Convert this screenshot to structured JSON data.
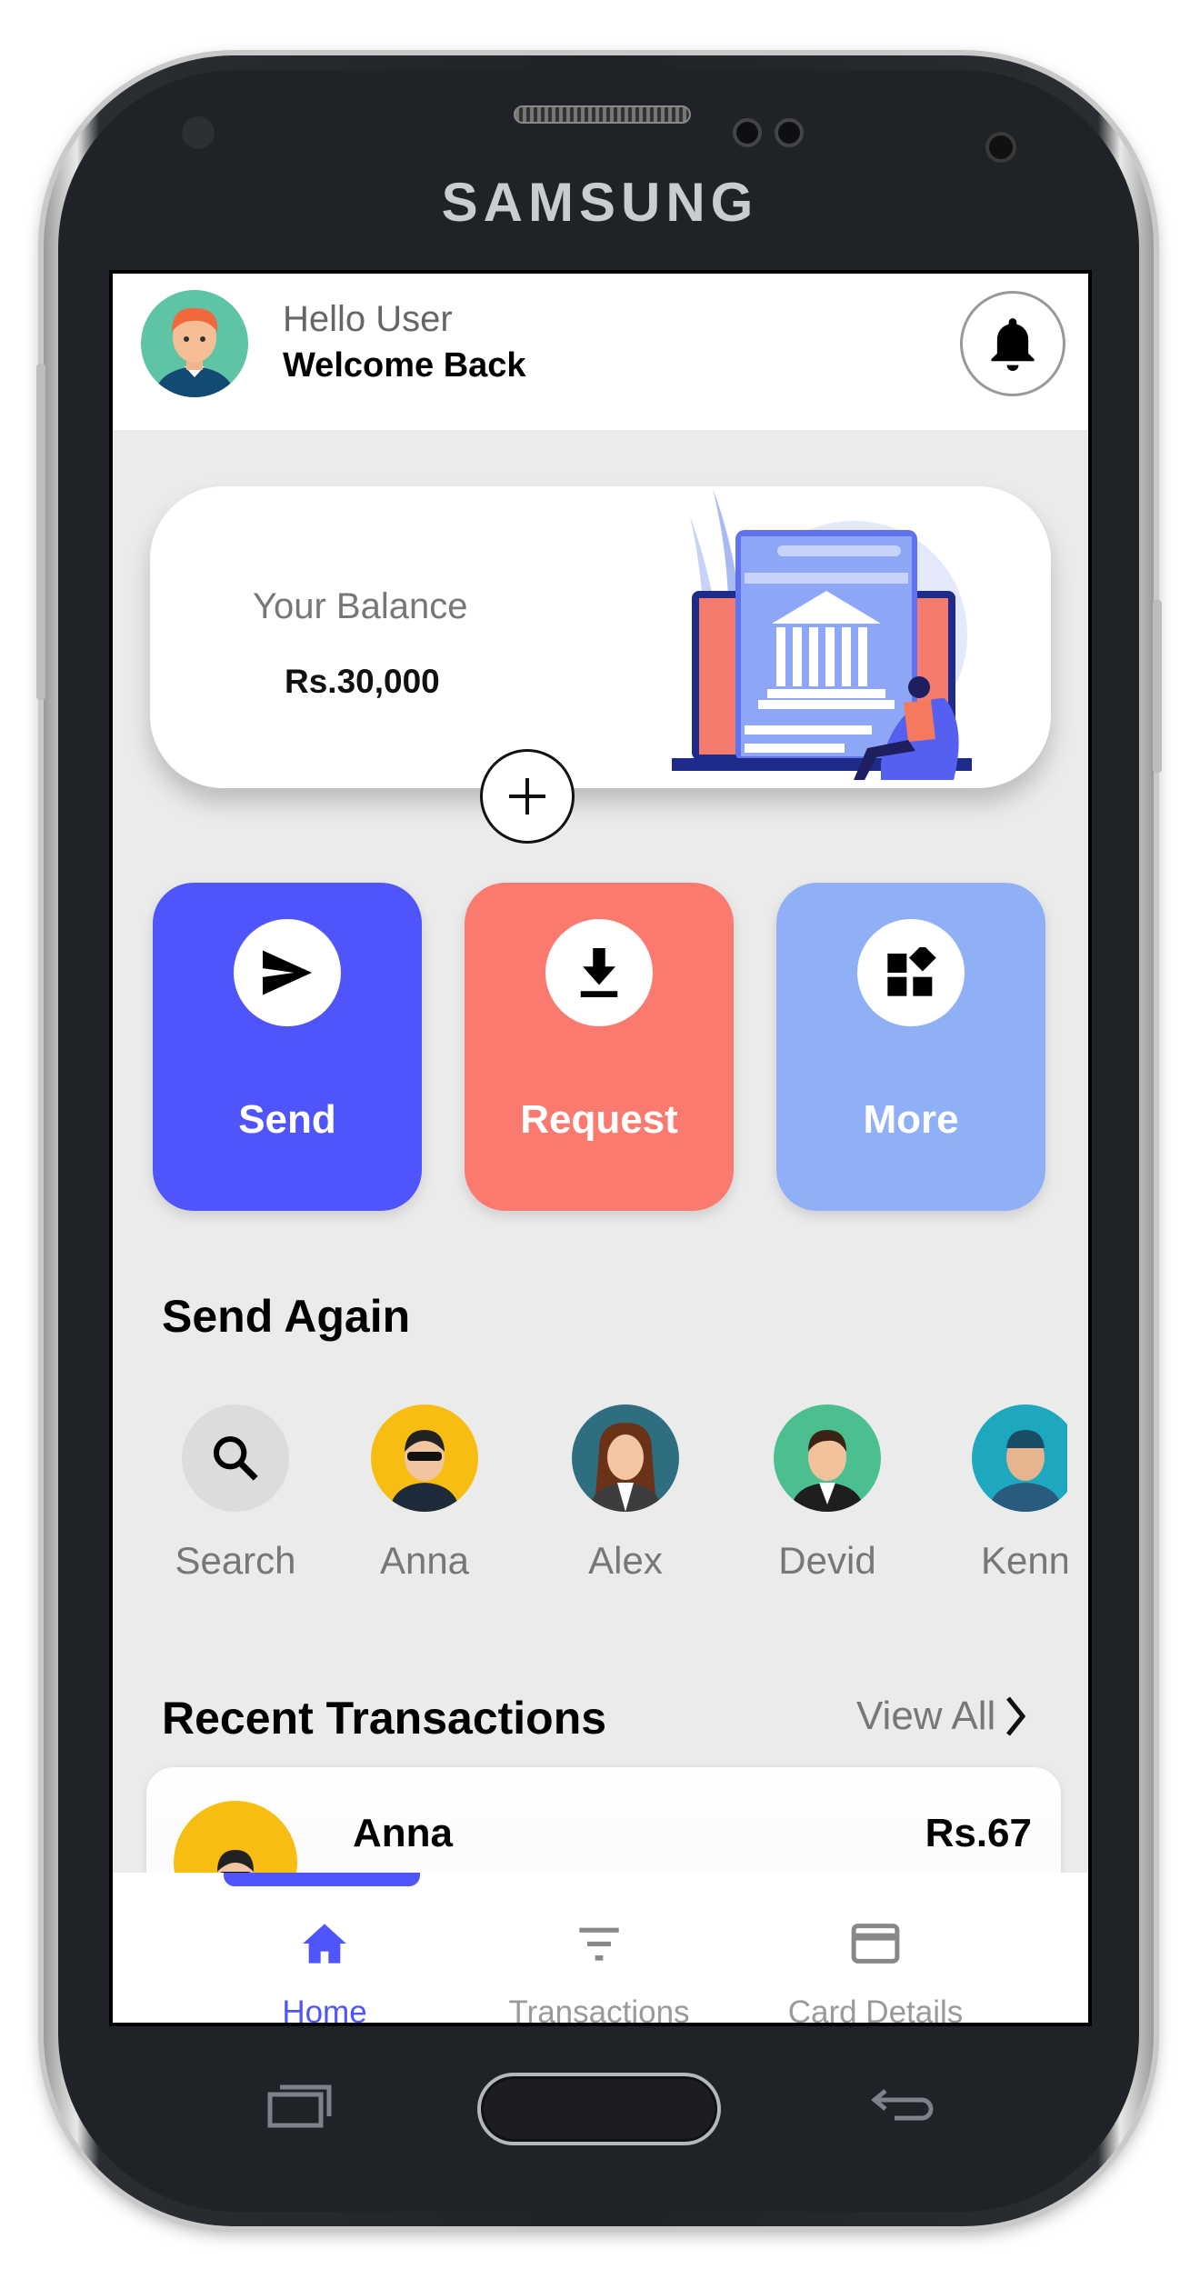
{
  "device": {
    "brand": "SAMSUNG"
  },
  "header": {
    "greeting": "Hello User",
    "subtitle": "Welcome Back",
    "notification_icon": "bell-icon"
  },
  "balance": {
    "label": "Your Balance",
    "amount": "Rs.30,000",
    "add_icon": "plus-icon"
  },
  "actions": [
    {
      "label": "Send",
      "icon": "send-icon",
      "color": "#4f55fb"
    },
    {
      "label": "Request",
      "icon": "download-icon",
      "color": "#fa7a6f"
    },
    {
      "label": "More",
      "icon": "widgets-icon",
      "color": "#8fb0f7"
    }
  ],
  "send_again": {
    "title": "Send Again",
    "contacts": [
      {
        "name": "Search",
        "icon": "search-icon"
      },
      {
        "name": "Anna"
      },
      {
        "name": "Alex"
      },
      {
        "name": "Devid"
      },
      {
        "name": "Kenn"
      }
    ]
  },
  "recent": {
    "title": "Recent Transactions",
    "view_all": "View All",
    "transactions": [
      {
        "name": "Anna",
        "amount": "Rs.67"
      }
    ]
  },
  "bottom_nav": {
    "active": "Home",
    "accent": "#4f55fb",
    "items": [
      {
        "label": "Home",
        "icon": "home-icon"
      },
      {
        "label": "Transactions",
        "icon": "filter-icon"
      },
      {
        "label": "Card Details",
        "icon": "credit-card-icon"
      }
    ]
  }
}
